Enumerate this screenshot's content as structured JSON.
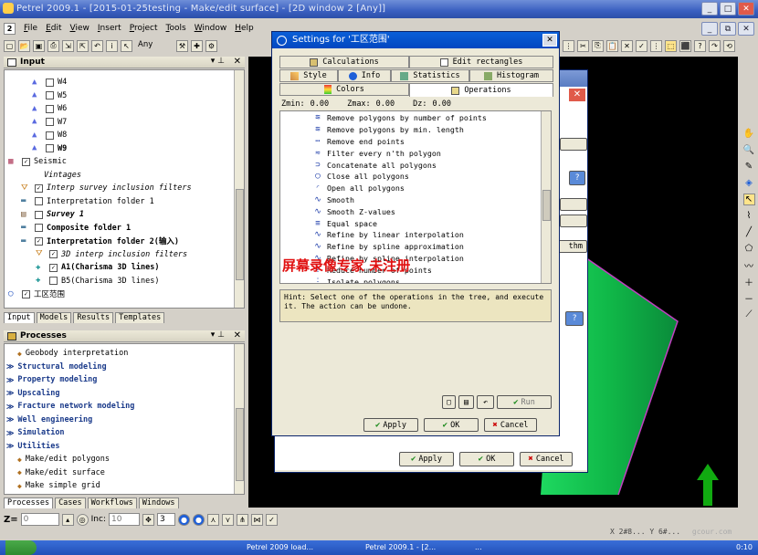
{
  "window": {
    "title": "Petrel 2009.1 - [2015-01-25testing - Make/edit surface] - [2D window 2 [Any]]",
    "buttons": [
      "_",
      "□",
      "✕"
    ],
    "mdi_buttons": [
      "_",
      "⧉",
      "✕"
    ]
  },
  "menu": [
    "File",
    "Edit",
    "View",
    "Insert",
    "Project",
    "Tools",
    "Window",
    "Help"
  ],
  "toolbar": {
    "mode_value": "Any"
  },
  "input_panel": {
    "title": "Input",
    "tabs": [
      "Input",
      "Models",
      "Results",
      "Templates"
    ],
    "rows": [
      {
        "label": "W4",
        "style": "normal"
      },
      {
        "label": "W5",
        "style": "normal"
      },
      {
        "label": "W6",
        "style": "normal"
      },
      {
        "label": "W7",
        "style": "normal"
      },
      {
        "label": "W8",
        "style": "normal"
      },
      {
        "label": "W9",
        "style": "bold"
      },
      {
        "label": "Seismic",
        "style": "normal"
      },
      {
        "label": "Vintages",
        "style": "italic"
      },
      {
        "label": "Interp survey inclusion filters",
        "style": "italic"
      },
      {
        "label": "Interpretation folder 1",
        "style": "normal"
      },
      {
        "label": "Survey 1",
        "style": "bolditalic"
      },
      {
        "label": "Composite folder 1",
        "style": "bold"
      },
      {
        "label": "Interpretation folder 2(输入)",
        "style": "bold"
      },
      {
        "label": "3D interp inclusion filters",
        "style": "italic"
      },
      {
        "label": "A1(Charisma 3D lines)",
        "style": "bold"
      },
      {
        "label": "B5(Charisma 3D lines)",
        "style": "normal"
      },
      {
        "label": "工区范围",
        "style": "normal"
      }
    ]
  },
  "processes_panel": {
    "title": "Processes",
    "tabs": [
      "Processes",
      "Cases",
      "Workflows",
      "Windows"
    ],
    "items": [
      {
        "label": "Geobody interpretation",
        "bold": false
      },
      {
        "label": "Structural modeling",
        "bold": true
      },
      {
        "label": "Property modeling",
        "bold": true
      },
      {
        "label": "Upscaling",
        "bold": true
      },
      {
        "label": "Fracture network modeling",
        "bold": true
      },
      {
        "label": "Well engineering",
        "bold": true
      },
      {
        "label": "Simulation",
        "bold": true
      },
      {
        "label": "Utilities",
        "bold": true
      },
      {
        "label": "Make/edit polygons",
        "bold": false
      },
      {
        "label": "Make/edit surface",
        "bold": false
      },
      {
        "label": "Make simple grid",
        "bold": false
      }
    ]
  },
  "bottom_toolbar": {
    "z_label": "Z=",
    "z_value": "0",
    "inc_label": "Inc:",
    "inc_value": "10",
    "count_value": "3"
  },
  "settings_dialog": {
    "title": "Settings for '工区范围'",
    "tabs_row1": [
      "Calculations",
      "Edit rectangles"
    ],
    "tabs_row2": [
      "Style",
      "Info",
      "Statistics",
      "Histogram"
    ],
    "tabs_row3": [
      "Colors",
      "Operations"
    ],
    "zmin_label": "Zmin:",
    "zmin": "0.00",
    "zmax_label": "Zmax:",
    "zmax": "0.00",
    "dz_label": "Dz:",
    "dz": "0.00",
    "operations": [
      "Remove polygons by number of points",
      "Remove polygons by min. length",
      "Remove end points",
      "Filter every n'th polygon",
      "Concatenate all polygons",
      "Close all polygons",
      "Open all polygons",
      "Smooth",
      "Smooth Z-values",
      "Equal space",
      "Refine by linear interpolation",
      "Refine by spline approximation",
      "Refine by spline interpolation",
      "Reduce number of points",
      "Isolate polygons"
    ],
    "watermark": "屏幕录像专家  未注册",
    "hint": "Hint: Select one of the operations in the tree, and execute it. The action can be undone.",
    "run_label": "Run",
    "apply_label": "Apply",
    "ok_label": "OK",
    "cancel_label": "Cancel"
  },
  "back_dialog": {
    "apply_label": "Apply",
    "ok_label": "OK",
    "cancel_label": "Cancel",
    "partial_label": "thm"
  },
  "status": {
    "coords": "X 2#8... Y 6#... ",
    "watermark": "gcour.com"
  },
  "taskbar": {
    "items": [
      "Petrel 2009 load...",
      "Petrel 2009.1 - [2...",
      "..."
    ],
    "clock": "0:10"
  },
  "colors": {
    "titlebar": "#2c4fa8",
    "viewport": "#000000",
    "surface_green": "#22cc55",
    "arrow": "#11aa11"
  }
}
